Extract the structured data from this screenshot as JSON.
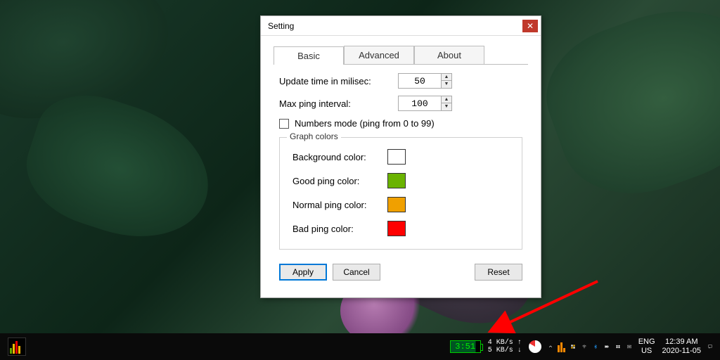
{
  "dialog": {
    "title": "Setting",
    "tabs": {
      "basic": "Basic",
      "advanced": "Advanced",
      "about": "About"
    },
    "fields": {
      "update_time_label": "Update time in milisec:",
      "update_time_value": "50",
      "max_ping_label": "Max ping interval:",
      "max_ping_value": "100",
      "numbers_mode_label": "Numbers mode (ping from 0 to 99)"
    },
    "graph_colors": {
      "legend": "Graph colors",
      "background_label": "Background color:",
      "background_value": "#ffffff",
      "good_label": "Good ping color:",
      "good_value": "#6ab300",
      "normal_label": "Normal ping color:",
      "normal_value": "#f0a000",
      "bad_label": "Bad ping color:",
      "bad_value": "#ff0000"
    },
    "buttons": {
      "apply": "Apply",
      "cancel": "Cancel",
      "reset": "Reset"
    }
  },
  "taskbar": {
    "battery_time": "3:51",
    "net_up": "4 KB/s ↑",
    "net_down": "5 KB/s ↓",
    "lang_top": "ENG",
    "lang_bottom": "US",
    "clock_time": "12:39 AM",
    "clock_date": "2020-11-05"
  }
}
